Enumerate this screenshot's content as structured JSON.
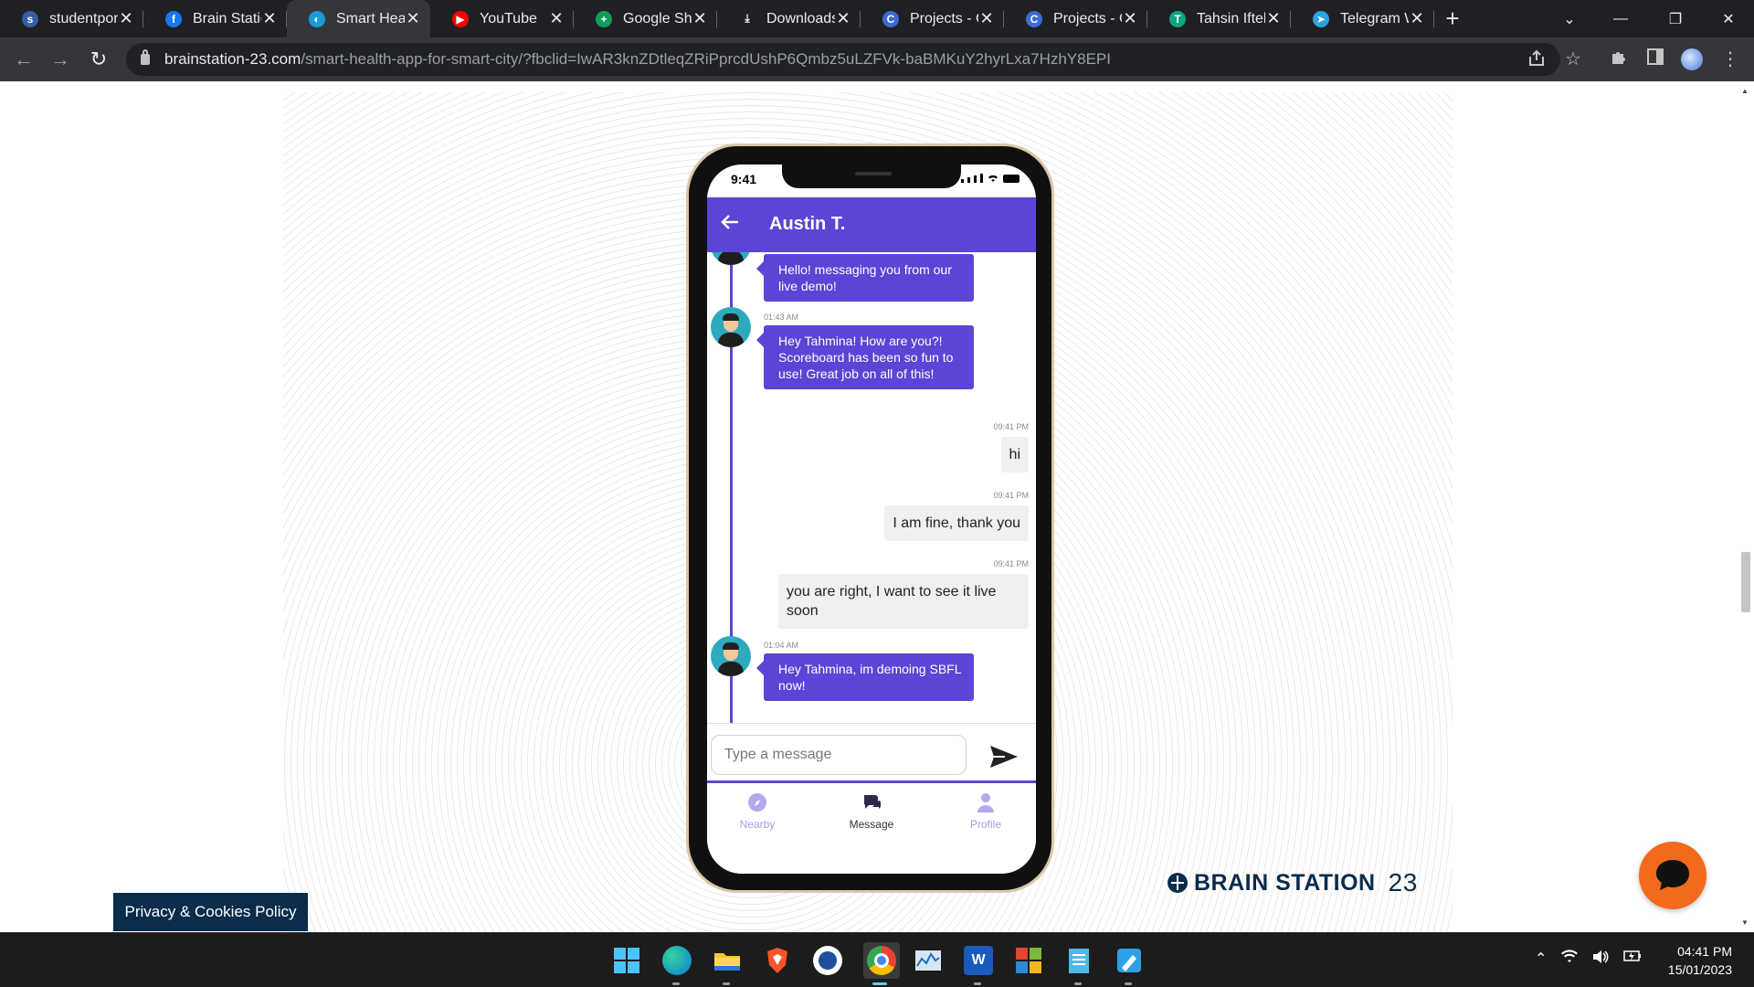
{
  "browser": {
    "tabs": [
      {
        "title": "studentport",
        "favicon_color": "#3b5ba5",
        "favicon_glyph": "s",
        "active": false
      },
      {
        "title": "Brain Statio",
        "favicon_color": "#1877f2",
        "favicon_glyph": "f",
        "active": false
      },
      {
        "title": "Smart Healt",
        "favicon_color": "#1a9ad6",
        "favicon_glyph": "◐",
        "active": true
      },
      {
        "title": "YouTube",
        "favicon_color": "#ff0000",
        "favicon_glyph": "▶",
        "active": false
      },
      {
        "title": "Google She",
        "favicon_color": "#0f9d58",
        "favicon_glyph": "+",
        "active": false
      },
      {
        "title": "Downloads",
        "favicon_color": "#1f2023",
        "favicon_glyph": "⤓",
        "active": false
      },
      {
        "title": "Projects - C",
        "favicon_color": "#3b6bd6",
        "favicon_glyph": "C",
        "active": false
      },
      {
        "title": "Projects - C",
        "favicon_color": "#3b6bd6",
        "favicon_glyph": "C",
        "active": false
      },
      {
        "title": "Tahsin Iftek",
        "favicon_color": "#10a37f",
        "favicon_glyph": "T",
        "active": false
      },
      {
        "title": "Telegram W",
        "favicon_color": "#2aa3e0",
        "favicon_glyph": "➤",
        "active": false
      }
    ],
    "new_tab_label": "+",
    "window_controls": {
      "tab_search": "⌄",
      "minimize": "—",
      "restore": "❐",
      "close": "✕"
    },
    "nav": {
      "back": "←",
      "forward": "→",
      "reload": "↻"
    },
    "url_host": "brainstation-23.com",
    "url_path": "/smart-health-app-for-smart-city/?fbclid=IwAR3knZDtleqZRiPprcdUshP6Qmbz5uLZFVk-baBMKuY2hyrLxa7HzhY8EPI",
    "toolbar_icons": [
      "share-icon",
      "star-icon",
      "extensions-icon",
      "side-panel-icon",
      "profile-avatar",
      "menu-icon"
    ]
  },
  "app": {
    "status_time": "9:41",
    "contact_name": "Austin T.",
    "accent_color": "#5b45d6",
    "messages": [
      {
        "direction": "in",
        "time": "",
        "text": "Hello! messaging you from our live demo!"
      },
      {
        "direction": "in",
        "time": "01:43 AM",
        "text": "Hey Tahmina! How are you?! Scoreboard has been so fun to use! Great job on all of this!"
      },
      {
        "direction": "out",
        "time": "09:41 PM",
        "text": "hi"
      },
      {
        "direction": "out",
        "time": "09:41 PM",
        "text": "I am fine, thank you"
      },
      {
        "direction": "out",
        "time": "09:41 PM",
        "text": "you are right, I want to see it live soon"
      },
      {
        "direction": "in",
        "time": "01:04 AM",
        "text": "Hey Tahmina, im demoing SBFL now!"
      }
    ],
    "input_placeholder": "Type a message",
    "nav": [
      {
        "label": "Nearby",
        "icon": "compass-icon",
        "active": false
      },
      {
        "label": "Message",
        "icon": "chat-bubbles-icon",
        "active": true
      },
      {
        "label": "Profile",
        "icon": "person-icon",
        "active": false
      }
    ]
  },
  "page": {
    "brand_text": "BRAIN STATION",
    "brand_number": "23",
    "privacy_label": "Privacy & Cookies Policy"
  },
  "taskbar": {
    "apps": [
      "windows-start-icon",
      "edge-icon",
      "file-explorer-icon",
      "brave-icon",
      "wps-icon",
      "chrome-icon",
      "resource-monitor-icon",
      "word-icon",
      "office-icon",
      "notepad-icon",
      "paint-icon"
    ],
    "tray_icons": [
      "chevron-up-icon",
      "wifi-icon",
      "volume-icon",
      "battery-icon"
    ],
    "clock_time": "04:41 PM",
    "clock_date": "15/01/2023"
  }
}
